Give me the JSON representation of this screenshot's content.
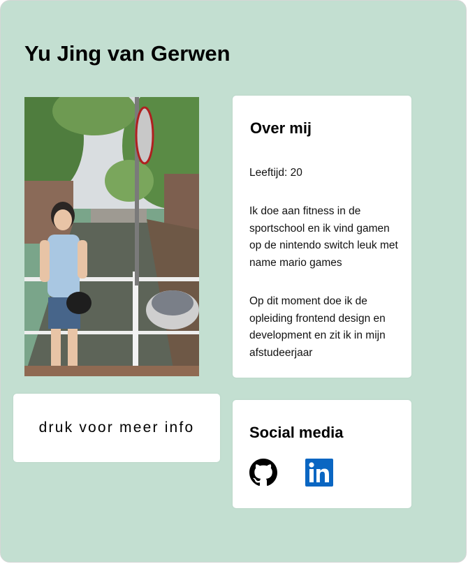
{
  "profile": {
    "name": "Yu Jing van Gerwen",
    "photo_icon": "profile-photo"
  },
  "more_button": {
    "label": "druk voor meer info"
  },
  "about": {
    "heading": "Over mij",
    "age_line": "Leeftijd: 20",
    "paragraph_1": "Ik doe aan fitness in de sportschool en ik vind gamen op de nintendo switch leuk met name mario games",
    "paragraph_2": "Op dit moment doe ik de opleiding frontend design en development en zit ik in mijn afstudeerjaar"
  },
  "social": {
    "heading": "Social media",
    "links": [
      {
        "name": "github",
        "icon": "github-icon",
        "color": "#000000"
      },
      {
        "name": "linkedin",
        "icon": "linkedin-icon",
        "color": "#0a66c2"
      }
    ]
  },
  "colors": {
    "background": "#c3dfd1",
    "panel": "#ffffff"
  }
}
